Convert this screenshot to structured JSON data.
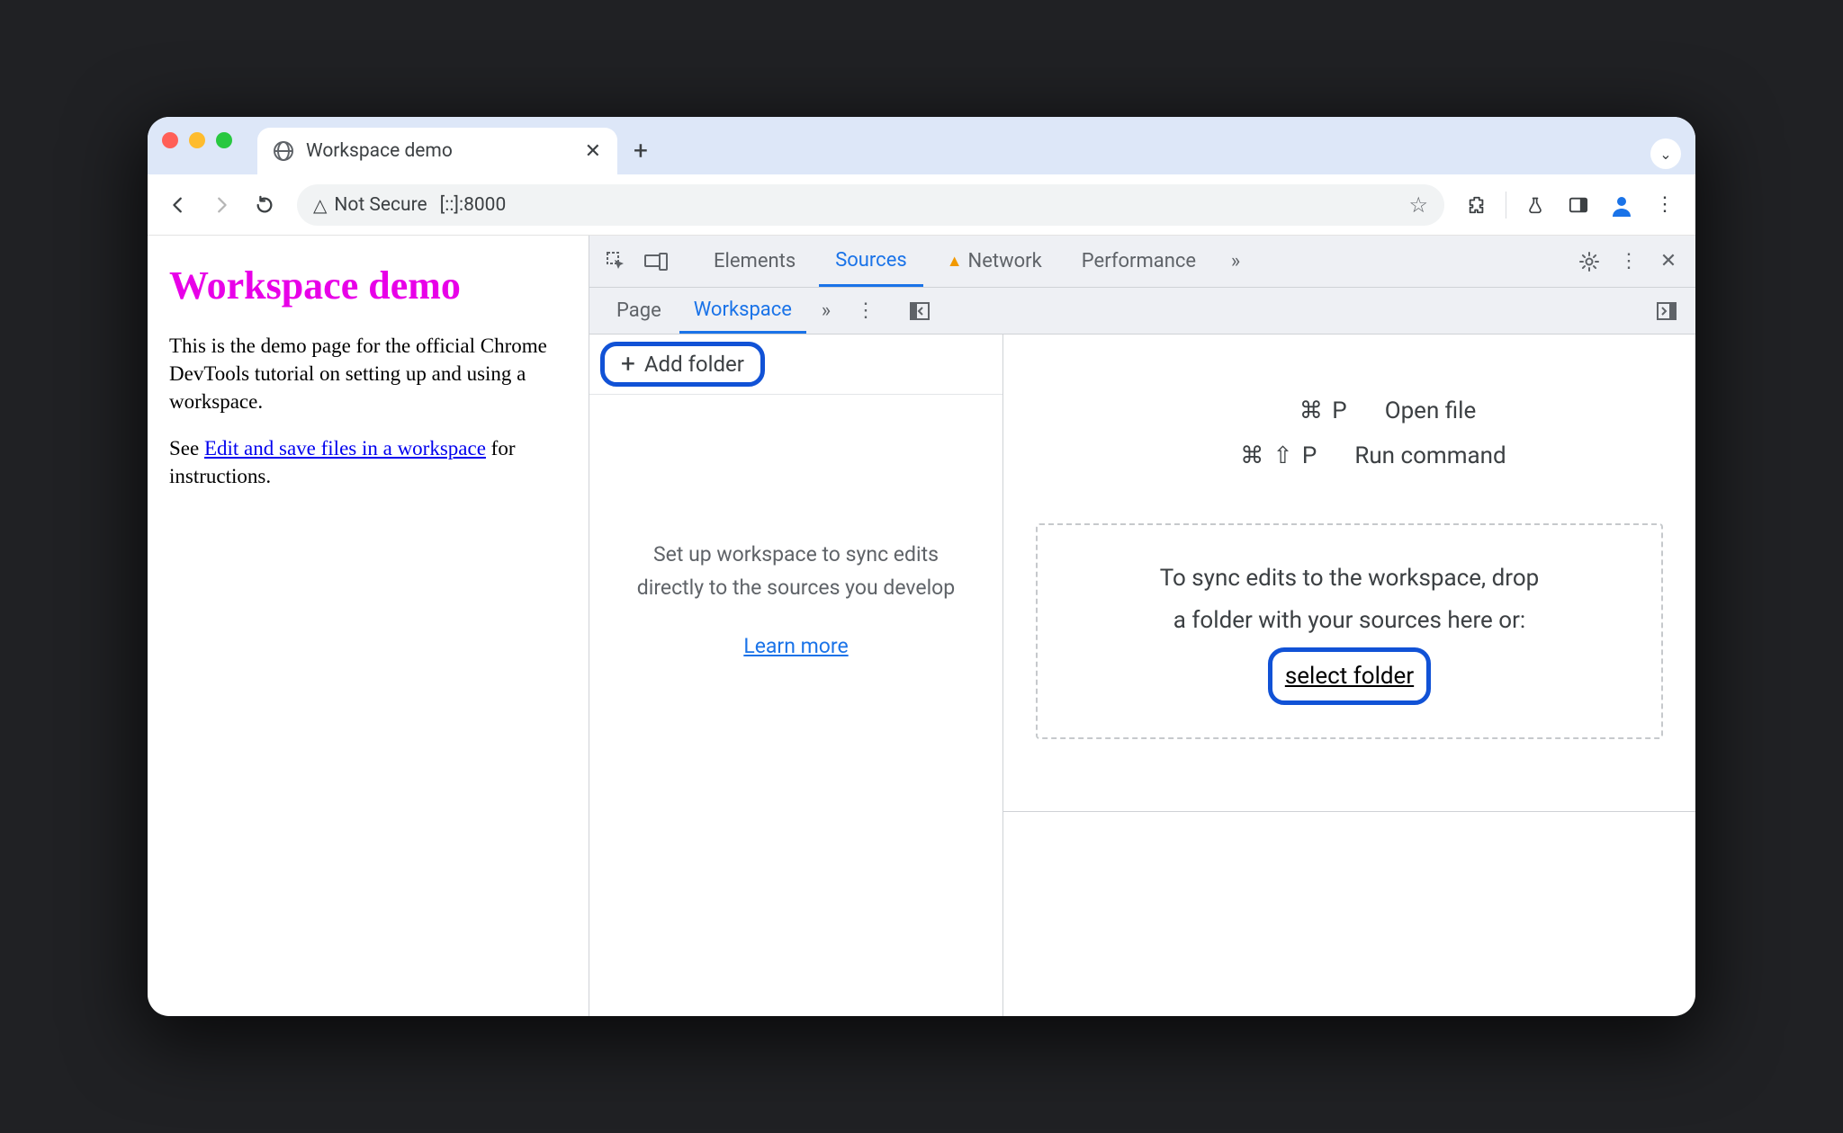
{
  "browser": {
    "tab_title": "Workspace demo",
    "security_label": "Not Secure",
    "url": "[::]:8000"
  },
  "page": {
    "heading": "Workspace demo",
    "p1": "This is the demo page for the official Chrome DevTools tutorial on setting up and using a workspace.",
    "see_prefix": "See ",
    "link_text": "Edit and save files in a workspace",
    "see_suffix": " for instructions."
  },
  "devtools": {
    "tabs": {
      "elements": "Elements",
      "sources": "Sources",
      "network": "Network",
      "performance": "Performance"
    },
    "subtabs": {
      "page": "Page",
      "workspace": "Workspace"
    },
    "add_folder": "Add folder",
    "ws_help": "Set up workspace to sync edits directly to the sources you develop",
    "learn_more": "Learn more",
    "shortcuts": {
      "open_file_keys": "⌘ P",
      "open_file_label": "Open file",
      "run_cmd_keys": "⌘ ⇧ P",
      "run_cmd_label": "Run command"
    },
    "dropzone": {
      "line1": "To sync edits to the workspace, drop",
      "line2": "a folder with your sources here or:",
      "select_folder": "select folder"
    }
  }
}
